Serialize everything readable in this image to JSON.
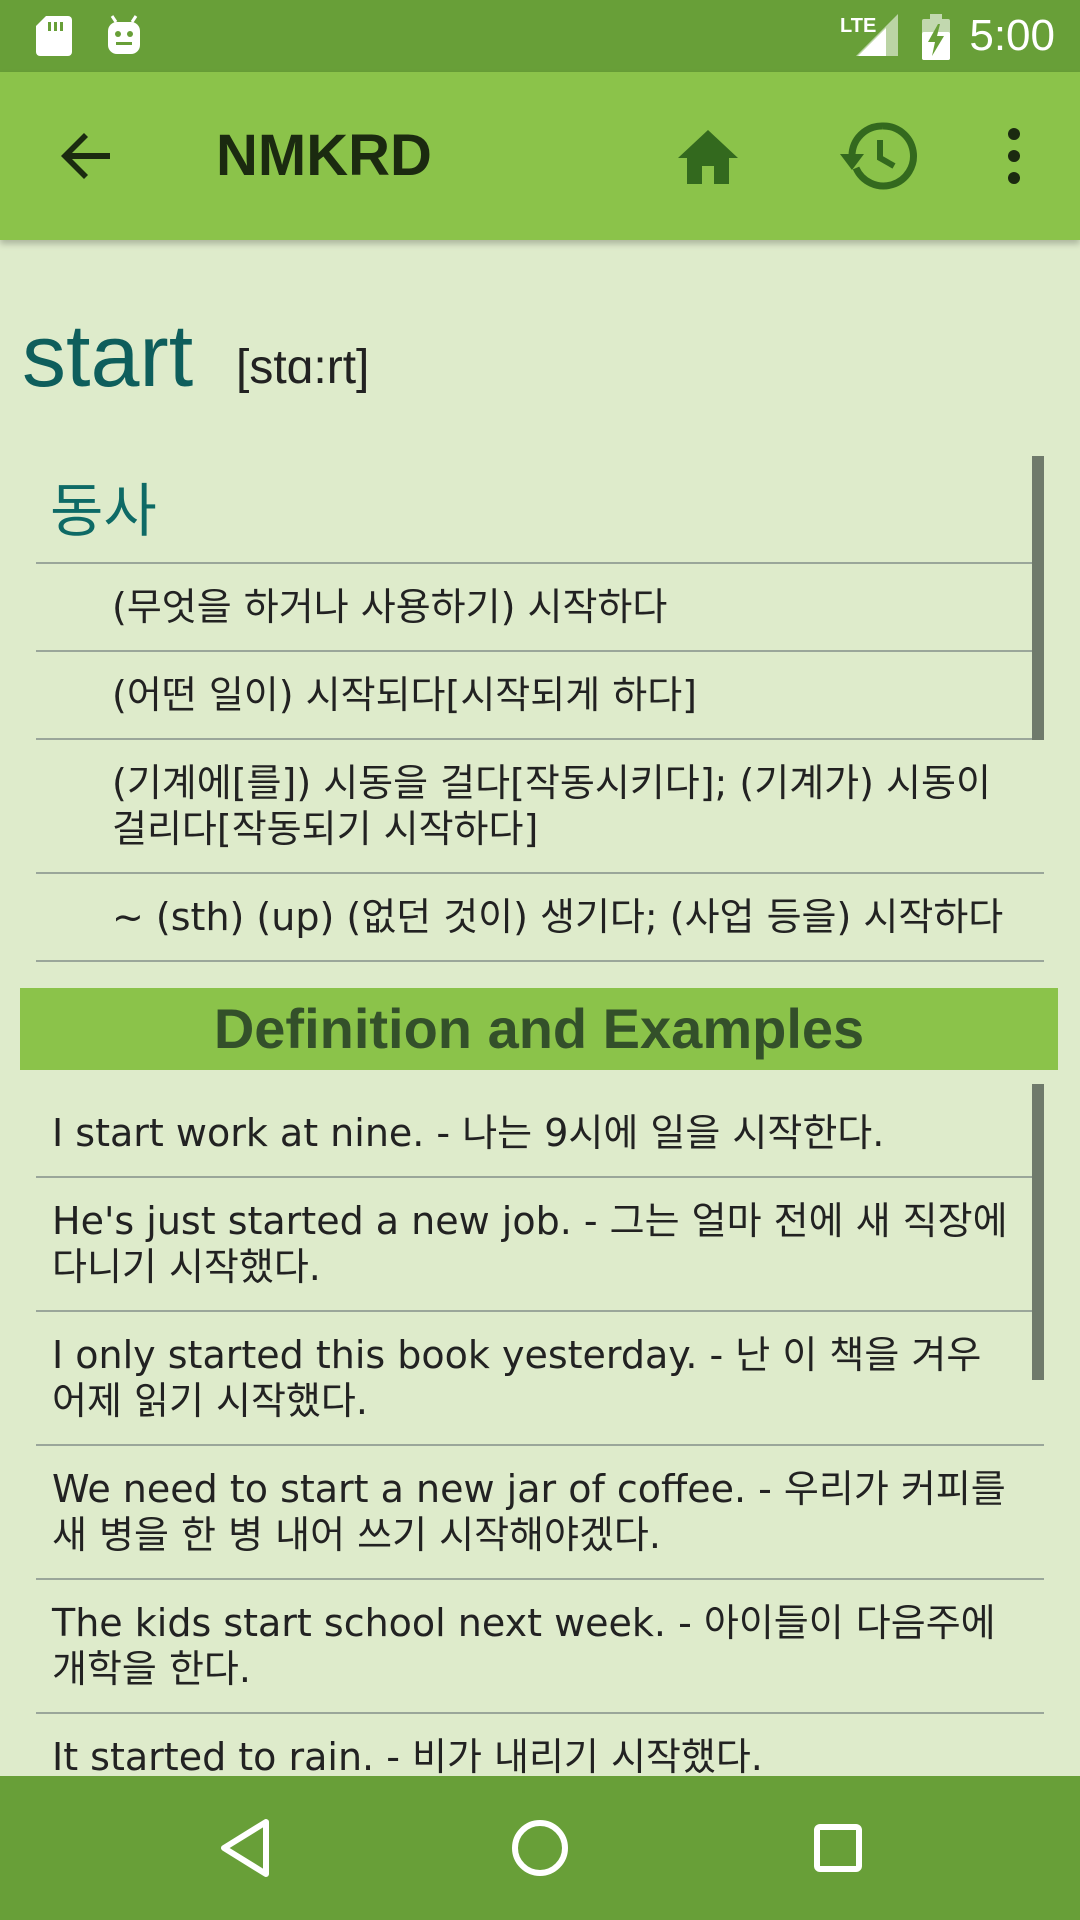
{
  "status_bar": {
    "network_label": "LTE",
    "time": "5:00",
    "icons": [
      "sd-card-icon",
      "android-debug-icon",
      "lte-signal-icon",
      "battery-charging-icon"
    ]
  },
  "app_bar": {
    "title": "NMKRD",
    "icons": [
      "back-arrow-icon",
      "home-icon",
      "history-icon",
      "more-vert-icon"
    ]
  },
  "entry": {
    "word": "start",
    "pronunciation": "[stɑ:rt]",
    "part_of_speech": "동사",
    "meanings": [
      "(무엇을 하거나 사용하기) 시작하다",
      "(어떤 일이) 시작되다[시작되게 하다]",
      "(기계에[를]) 시동을 걸다[작동시키다]; (기계가) 시동이 걸리다[작동되기 시작하다]",
      "~ (sth) (up) (없던 것이) 생기다; (사업 등을) 시작하다"
    ]
  },
  "examples_section": {
    "title": "Definition and Examples",
    "items": [
      "I start work at nine. - 나는 9시에 일을 시작한다.",
      "He's just started a new job. - 그는 얼마 전에 새 직장에 다니기 시작했다.",
      "I only started this book yesterday. - 난 이 책을 겨우 어제 읽기 시작했다.",
      "We need to start a new jar of coffee. - 우리가 커피를 새 병을 한 병 내어 쓰기 시작해야겠다.",
      "The kids start school next week. - 아이들이 다음주에 개학을 한다.",
      "It started to rain. - 비가 내리기 시작했다."
    ]
  },
  "nav_bar": {
    "icons": [
      "nav-back-icon",
      "nav-home-icon",
      "nav-recents-icon"
    ]
  },
  "colors": {
    "status_bar": "#689F38",
    "app_bar": "#8BC34A",
    "background": "#DEEBCB",
    "headword": "#0E5E5C",
    "section_header_text": "#33502A"
  }
}
